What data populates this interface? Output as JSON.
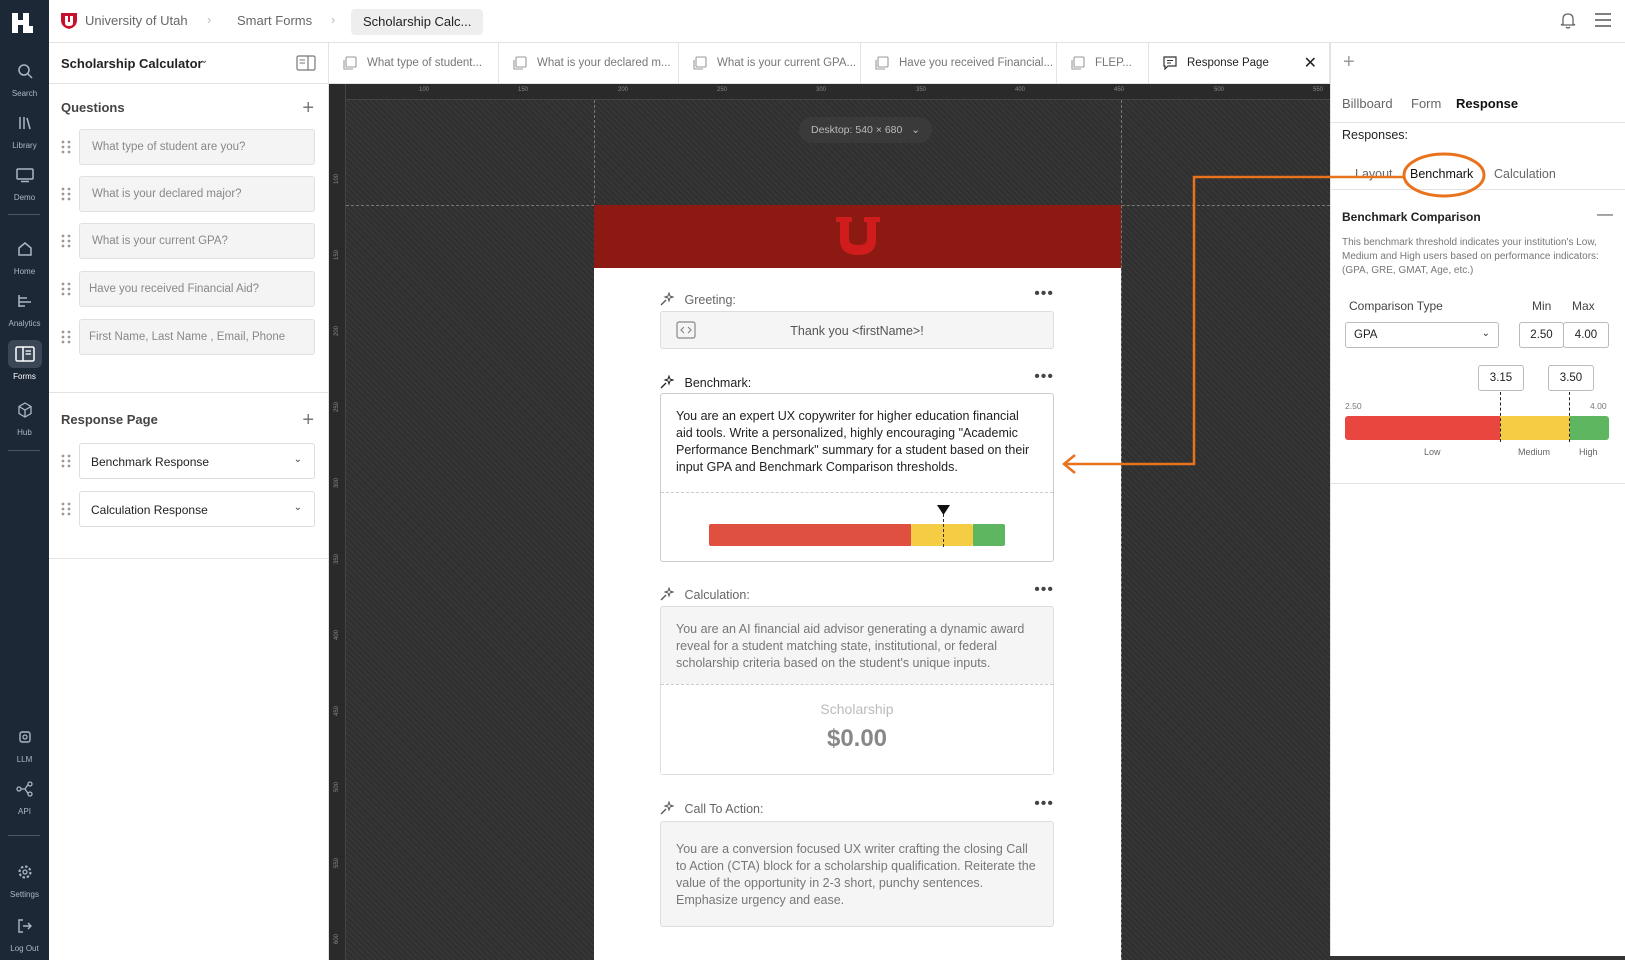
{
  "nav": {
    "items": [
      {
        "label": "Search",
        "icon": "search-icon"
      },
      {
        "label": "Library",
        "icon": "library-icon"
      },
      {
        "label": "Demo",
        "icon": "monitor-icon"
      },
      {
        "label": "Home",
        "icon": "home-icon"
      },
      {
        "label": "Analytics",
        "icon": "analytics-icon"
      },
      {
        "label": "Forms",
        "icon": "forms-icon"
      },
      {
        "label": "Hub",
        "icon": "cube-icon"
      },
      {
        "label": "LLM",
        "icon": "chip-icon"
      },
      {
        "label": "API",
        "icon": "api-icon"
      },
      {
        "label": "Settings",
        "icon": "gear-icon"
      },
      {
        "label": "Log Out",
        "icon": "logout-icon"
      }
    ],
    "active": "Forms"
  },
  "breadcrumb": {
    "org": "University of Utah",
    "section": "Smart Forms",
    "current": "Scholarship Calc..."
  },
  "left_panel": {
    "title": "Scholarship Calculator",
    "questions_title": "Questions",
    "questions": [
      "What type of student are you?",
      "What is your declared major?",
      "What is your current GPA?",
      "Have you received Financial Aid?",
      "First Name, Last Name , Email, Phone"
    ],
    "response_title": "Response Page",
    "responses": [
      "Benchmark Response",
      "Calculation Response"
    ]
  },
  "tabs": [
    {
      "label": "What type of student..."
    },
    {
      "label": "What is your declared m..."
    },
    {
      "label": "What is your current GPA..."
    },
    {
      "label": "Have you received Financial..."
    },
    {
      "label": "FLEP..."
    },
    {
      "label": "Response Page"
    }
  ],
  "canvas": {
    "device_label": "Desktop: 540 × 680",
    "ruler_x": [
      "100",
      "150",
      "200",
      "250",
      "300",
      "350",
      "400",
      "450",
      "500",
      "550"
    ],
    "ruler_y": [
      "100",
      "150",
      "200",
      "250",
      "300",
      "350",
      "400",
      "450",
      "500",
      "550",
      "600"
    ]
  },
  "page": {
    "greeting_label": "Greeting:",
    "greeting_text": "Thank you <firstName>!",
    "benchmark_label": "Benchmark:",
    "benchmark_prompt": "You are an expert UX copywriter for higher education financial aid tools. Write a personalized, highly encouraging \"Academic Performance Benchmark\" summary for a student based on their input GPA and Benchmark Comparison thresholds.",
    "calculation_label": "Calculation:",
    "calculation_prompt": "You are an AI financial aid advisor generating a dynamic award reveal for a student matching state, institutional, or federal scholarship criteria based on the student's unique inputs.",
    "scholarship_label": "Scholarship",
    "scholarship_amount": "$0.00",
    "cta_label": "Call To Action:",
    "cta_prompt": "You are a conversion focused UX writer crafting the closing Call to Action (CTA) block for a scholarship qualification. Reiterate the value of the opportunity in 2-3 short, punchy sentences. Emphasize urgency and ease."
  },
  "right_panel": {
    "tabs": [
      "Billboard",
      "Form",
      "Response"
    ],
    "active_tab": "Response",
    "responses_label": "Responses:",
    "sub_tabs": [
      "Layout",
      "Benchmark",
      "Calculation"
    ],
    "active_sub_tab": "Benchmark",
    "benchmark_title": "Benchmark Comparison",
    "benchmark_desc": "This benchmark threshold indicates your institution's Low, Medium and High users based on performance indicators: (GPA, GRE, GMAT, Age, etc.)",
    "comparison_type_label": "Comparison Type",
    "min_label": "Min",
    "max_label": "Max",
    "comparison_type": "GPA",
    "min": "2.50",
    "max": "4.00",
    "threshold_low": "3.15",
    "threshold_high": "3.50",
    "scale_min": "2.50",
    "scale_max": "4.00",
    "zones": [
      "Low",
      "Medium",
      "High"
    ]
  },
  "colors": {
    "brand_red": "#8c1a12",
    "low": "#e8463e",
    "medium": "#f5cd45",
    "high": "#5fb661",
    "annotation": "#e8731c"
  }
}
